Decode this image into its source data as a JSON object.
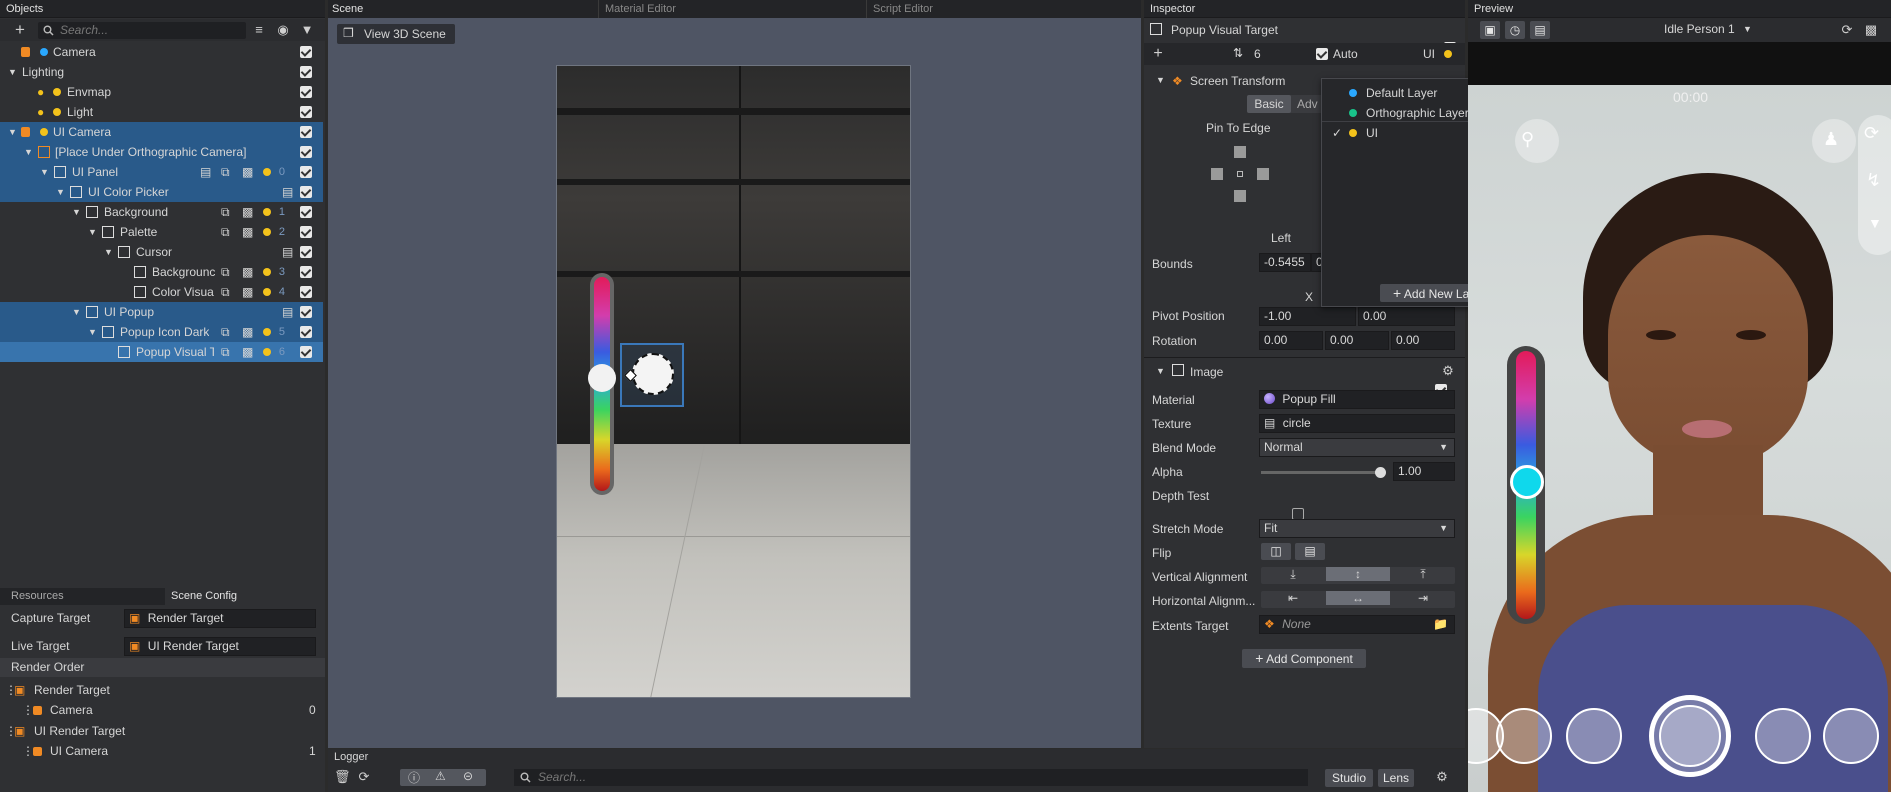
{
  "objects": {
    "title": "Objects",
    "search_placeholder": "Search...",
    "items": [
      {
        "label": "Camera"
      },
      {
        "label": "Lighting"
      },
      {
        "label": "Envmap"
      },
      {
        "label": "Light"
      },
      {
        "label": "UI Camera"
      },
      {
        "label": "[Place Under Orthographic Camera]"
      },
      {
        "label": "UI Panel",
        "num": "0"
      },
      {
        "label": "UI Color Picker"
      },
      {
        "label": "Background",
        "num": "1"
      },
      {
        "label": "Palette",
        "num": "2"
      },
      {
        "label": "Cursor"
      },
      {
        "label": "Backgrounc",
        "num": "3"
      },
      {
        "label": "Color Visua",
        "num": "4"
      },
      {
        "label": "UI Popup"
      },
      {
        "label": "Popup Icon Dark",
        "num": "5"
      },
      {
        "label": "Popup Visual T",
        "num": "6"
      }
    ]
  },
  "resources": {
    "tab_resources": "Resources",
    "tab_scene_config": "Scene Config",
    "capture_label": "Capture Target",
    "capture_value": "Render Target",
    "live_label": "Live Target",
    "live_value": "UI Render Target",
    "render_order_label": "Render Order",
    "order": [
      {
        "target": "Render Target",
        "camera": "Camera",
        "num": "0"
      },
      {
        "target": "UI Render Target",
        "camera": "UI Camera",
        "num": "1"
      }
    ]
  },
  "scene": {
    "tab_scene": "Scene",
    "tab_material": "Material Editor",
    "tab_script": "Script Editor",
    "view3d_label": "View 3D Scene"
  },
  "logger": {
    "title": "Logger",
    "search_placeholder": "Search...",
    "studio_label": "Studio",
    "lens_label": "Lens"
  },
  "inspector": {
    "title": "Inspector",
    "object_name": "Popup Visual Target",
    "layer_count": "6",
    "auto_label": "Auto",
    "layer_short": "UI",
    "screen_transform_label": "Screen Transform",
    "basic_tab": "Basic",
    "advanced_tab": "Adv",
    "pin_to_edge": "Pin To Edge",
    "left_label": "Left",
    "bounds_label": "Bounds",
    "bounds_left": "-0.5455",
    "bounds_right": "0",
    "x_label": "X",
    "pivot_label": "Pivot Position",
    "pivot_x": "-1.00",
    "pivot_y": "0.00",
    "rotation_label": "Rotation",
    "rot_x": "0.00",
    "rot_y": "0.00",
    "rot_z": "0.00",
    "image_label": "Image",
    "material_label": "Material",
    "material_value": "Popup Fill",
    "texture_label": "Texture",
    "texture_value": "circle",
    "blend_label": "Blend Mode",
    "blend_value": "Normal",
    "alpha_label": "Alpha",
    "alpha_value": "1.00",
    "alpha_level": 1.0,
    "depth_label": "Depth Test",
    "stretch_label": "Stretch Mode",
    "stretch_value": "Fit",
    "flip_label": "Flip",
    "valign_label": "Vertical Alignment",
    "halign_label": "Horizontal Alignm...",
    "extents_label": "Extents Target",
    "extents_value": "None",
    "add_component": "Add Component"
  },
  "layer_popup": {
    "items": [
      "Default Layer",
      "Orthographic Layer",
      "UI"
    ],
    "add_new": "Add New Layer"
  },
  "preview": {
    "title": "Preview",
    "person": "Idle Person 1",
    "timer": "00:00"
  }
}
